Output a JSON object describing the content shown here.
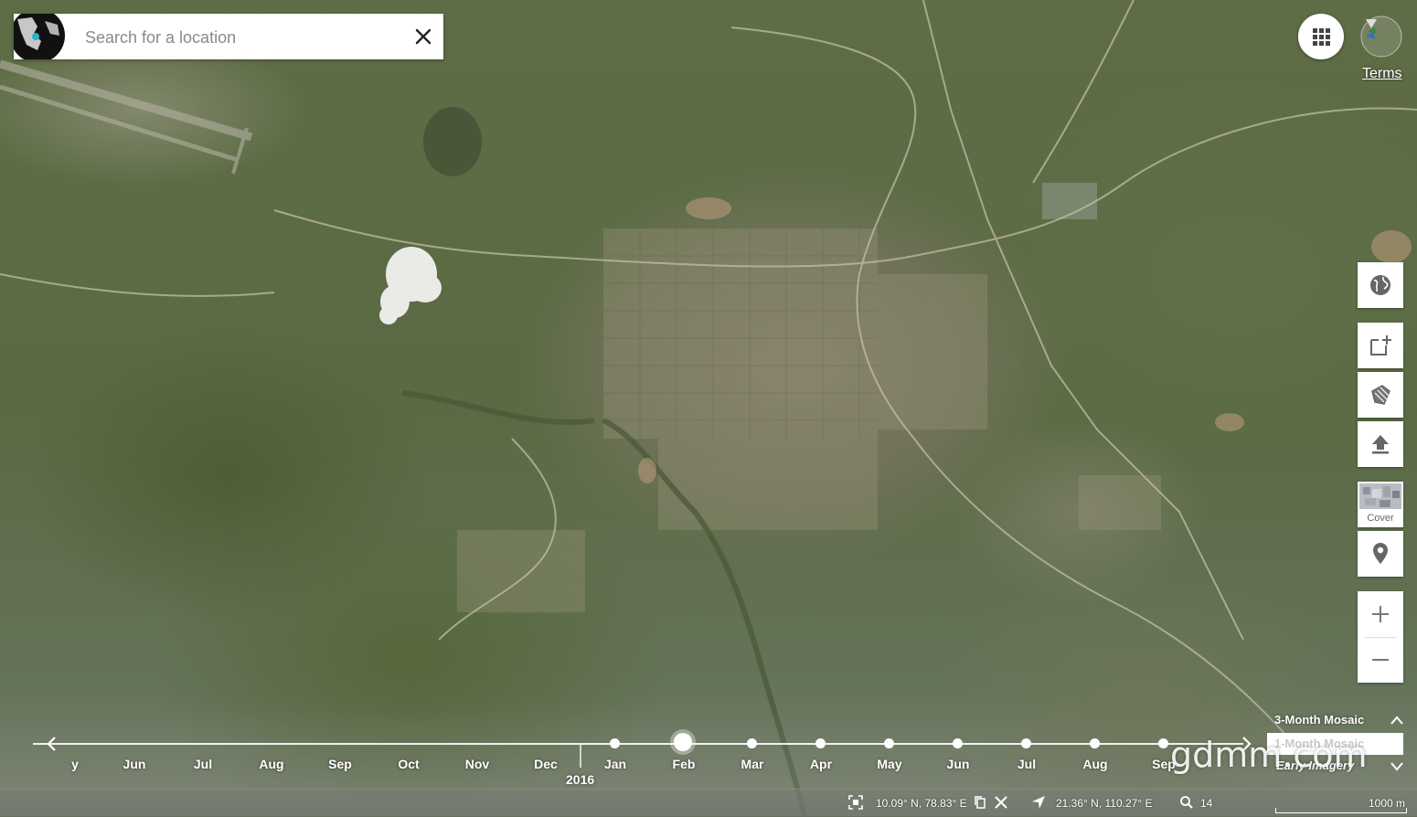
{
  "search": {
    "placeholder": "Search for a location",
    "globe_icon": "globe-thumbnail-icon",
    "close_icon": "close-icon"
  },
  "top_right": {
    "apps_icon": "apps-grid-icon",
    "avatar_icon": "user-avatar-icon",
    "terms_label": "Terms"
  },
  "tools": [
    {
      "name": "globe-button",
      "icon": "globe-icon"
    },
    {
      "name": "add-layer-button",
      "icon": "add-square-icon"
    },
    {
      "name": "draw-shape-button",
      "icon": "polygon-icon"
    },
    {
      "name": "upload-button",
      "icon": "upload-icon"
    },
    {
      "name": "cover-button",
      "icon": "cover-thumbnail-icon",
      "label": "Cover"
    },
    {
      "name": "location-pin-button",
      "icon": "location-pin-icon"
    }
  ],
  "zoom": {
    "in_icon": "plus-icon",
    "out_icon": "minus-icon"
  },
  "timeline": {
    "months_before": [
      "y",
      "Jun",
      "Jul",
      "Aug",
      "Sep",
      "Oct",
      "Nov",
      "Dec"
    ],
    "months_after": [
      "Jan",
      "Feb",
      "Mar",
      "Apr",
      "May",
      "Jun",
      "Jul",
      "Aug",
      "Sep"
    ],
    "year_label": "2016",
    "selected": "Feb",
    "prev_icon": "chevron-left-icon",
    "next_icon": "chevron-right-icon"
  },
  "mosaic": {
    "options": [
      "3-Month Mosaic",
      "1-Month Mosaic",
      "Early Imagery"
    ],
    "selected": "1-Month Mosaic",
    "up_icon": "chevron-up-icon",
    "down_icon": "chevron-down-icon"
  },
  "watermark": "gdmm.com",
  "status": {
    "bounds_icon": "area-bounds-icon",
    "cursor_coords": "10.09° N, 78.83° E",
    "copy_icon": "copy-icon",
    "clear_icon": "close-icon",
    "nav_icon": "navigation-arrow-icon",
    "center_coords": "21.36° N, 110.27° E",
    "zoom_icon": "magnifier-icon",
    "zoom_level": "14",
    "scale_label": "1000 m"
  },
  "colors": {
    "accent": "#ffffff",
    "map_green": "#5a6a43"
  }
}
